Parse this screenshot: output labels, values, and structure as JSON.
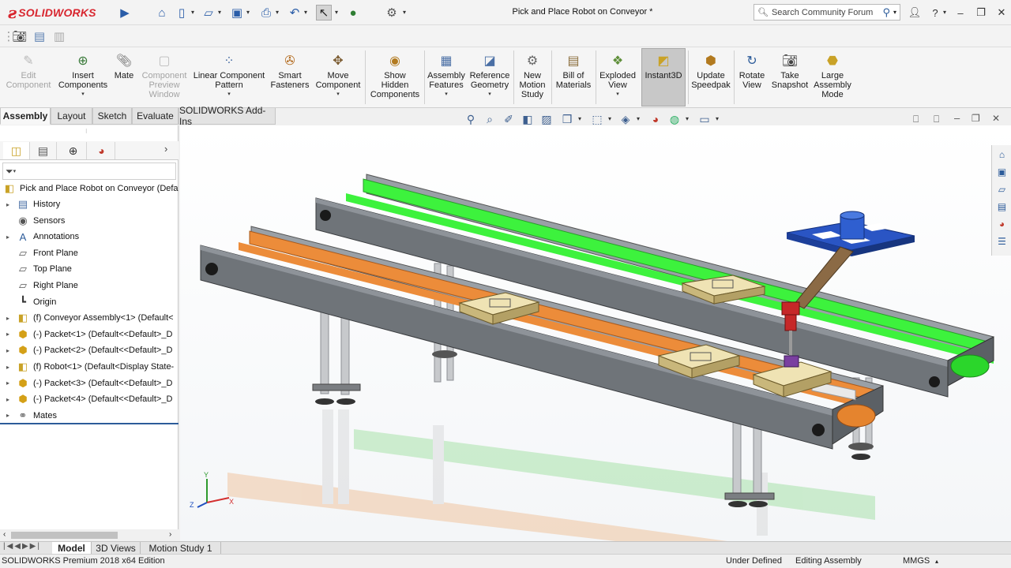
{
  "app": {
    "logo_text": "SOLIDWORKS",
    "window_title": "Pick and Place Robot on Conveyor *",
    "search_placeholder": "Search Community Forum"
  },
  "command_manager": {
    "items": [
      {
        "label": "Edit\nComponent",
        "icon": "edit-component-icon",
        "enabled": false
      },
      {
        "label": "Insert\nComponents",
        "icon": "insert-components-icon",
        "enabled": true,
        "dropdown": true
      },
      {
        "label": "Mate",
        "icon": "mate-icon",
        "enabled": true
      },
      {
        "label": "Component\nPreview\nWindow",
        "icon": "component-preview-icon",
        "enabled": false
      },
      {
        "label": "Linear Component\nPattern",
        "icon": "linear-pattern-icon",
        "enabled": true,
        "dropdown": true
      },
      {
        "label": "Smart\nFasteners",
        "icon": "smart-fasteners-icon",
        "enabled": true
      },
      {
        "label": "Move\nComponent",
        "icon": "move-component-icon",
        "enabled": true,
        "dropdown": true
      },
      {
        "label": "Show\nHidden\nComponents",
        "icon": "show-hidden-icon",
        "enabled": true
      },
      {
        "label": "Assembly\nFeatures",
        "icon": "assembly-features-icon",
        "enabled": true,
        "dropdown": true
      },
      {
        "label": "Reference\nGeometry",
        "icon": "reference-geometry-icon",
        "enabled": true,
        "dropdown": true
      },
      {
        "label": "New\nMotion\nStudy",
        "icon": "motion-study-icon",
        "enabled": true
      },
      {
        "label": "Bill of\nMaterials",
        "icon": "bill-of-materials-icon",
        "enabled": true
      },
      {
        "label": "Exploded\nView",
        "icon": "exploded-view-icon",
        "enabled": true,
        "dropdown": true
      },
      {
        "label": "Instant3D",
        "icon": "instant3d-icon",
        "enabled": true,
        "active": true
      },
      {
        "label": "Update\nSpeedpak",
        "icon": "speedpak-icon",
        "enabled": true
      },
      {
        "label": "Rotate\nView",
        "icon": "rotate-view-icon",
        "enabled": true
      },
      {
        "label": "Take\nSnapshot",
        "icon": "snapshot-icon",
        "enabled": true
      },
      {
        "label": "Large\nAssembly\nMode",
        "icon": "large-assembly-icon",
        "enabled": true
      }
    ]
  },
  "tabs": [
    "Assembly",
    "Layout",
    "Sketch",
    "Evaluate",
    "SOLIDWORKS Add-Ins"
  ],
  "active_tab": "Assembly",
  "feature_tree": {
    "filter_icon": "funnel-icon",
    "root": "Pick and Place Robot on Conveyor  (Defa",
    "items": [
      {
        "label": "History",
        "icon": "history-icon",
        "expandable": true
      },
      {
        "label": "Sensors",
        "icon": "sensors-icon",
        "expandable": false
      },
      {
        "label": "Annotations",
        "icon": "annotations-icon",
        "expandable": true
      },
      {
        "label": "Front Plane",
        "icon": "plane-icon",
        "expandable": false
      },
      {
        "label": "Top Plane",
        "icon": "plane-icon",
        "expandable": false
      },
      {
        "label": "Right Plane",
        "icon": "plane-icon",
        "expandable": false
      },
      {
        "label": "Origin",
        "icon": "origin-icon",
        "expandable": false
      },
      {
        "label": "(f) Conveyor Assembly<1> (Default<",
        "icon": "subassembly-icon",
        "expandable": true
      },
      {
        "label": "(-) Packet<1> (Default<<Default>_D",
        "icon": "part-icon",
        "expandable": true
      },
      {
        "label": "(-) Packet<2> (Default<<Default>_D",
        "icon": "part-icon",
        "expandable": true
      },
      {
        "label": "(f) Robot<1> (Default<Display State-",
        "icon": "subassembly-icon",
        "expandable": true
      },
      {
        "label": "(-) Packet<3> (Default<<Default>_D",
        "icon": "part-icon",
        "expandable": true
      },
      {
        "label": "(-) Packet<4> (Default<<Default>_D",
        "icon": "part-icon",
        "expandable": true
      },
      {
        "label": "Mates",
        "icon": "mates-icon",
        "expandable": true
      }
    ]
  },
  "bottom_tabs": [
    "Model",
    "3D Views",
    "Motion Study 1"
  ],
  "active_bottom_tab": "Model",
  "status": {
    "edition": "SOLIDWORKS Premium 2018 x64 Edition",
    "state": "Under Defined",
    "mode": "Editing Assembly",
    "units": "MMGS"
  },
  "triad": {
    "x": "X",
    "y": "Y",
    "z": "Z"
  },
  "colors": {
    "conveyor_front": "#ec8c3a",
    "conveyor_back": "#3df23d",
    "frame": "#6f7479",
    "packet": "#d8c995",
    "robot_base": "#2a55c4",
    "robot_arm": "#8b6a45",
    "gripper": "#c62828"
  }
}
